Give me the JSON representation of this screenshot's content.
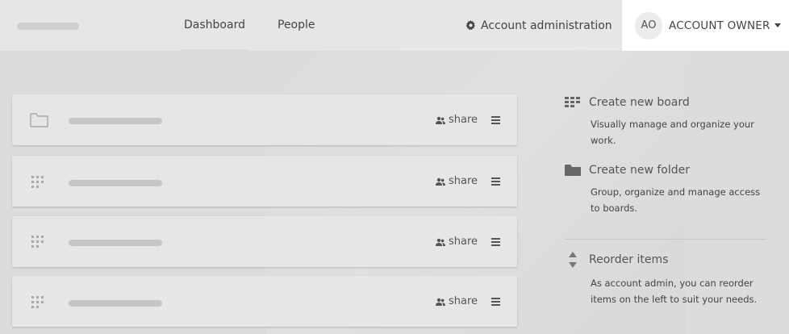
{
  "nav": {
    "tabs": [
      {
        "label": "Dashboard",
        "active": true
      },
      {
        "label": "People",
        "active": false
      }
    ],
    "admin_label": "Account administration",
    "account": {
      "initials": "AO",
      "name": "ACCOUNT OWNER"
    }
  },
  "cards": [
    {
      "kind": "folder",
      "share_label": "share"
    },
    {
      "kind": "board",
      "share_label": "share"
    },
    {
      "kind": "board",
      "share_label": "share"
    },
    {
      "kind": "board",
      "share_label": "share"
    }
  ],
  "side": {
    "create_board": {
      "title": "Create new board",
      "desc": "Visually manage and organize your work."
    },
    "create_folder": {
      "title": "Create new folder",
      "desc": "Group, organize and manage access to boards."
    },
    "reorder": {
      "title": "Reorder items",
      "desc": "As account admin, you can reorder items on the left to suit your needs."
    }
  },
  "icons": {
    "gear": "gear-icon",
    "share": "people-icon",
    "menu": "hamburger-icon",
    "folder": "folder-icon",
    "board": "board-grid-icon",
    "reorder": "sort-arrows-icon"
  },
  "colors": {
    "background": "#dcdcdc",
    "topbar": "#e6e6e6",
    "card": "#e6e6e6",
    "account_bg": "#ffffff"
  }
}
